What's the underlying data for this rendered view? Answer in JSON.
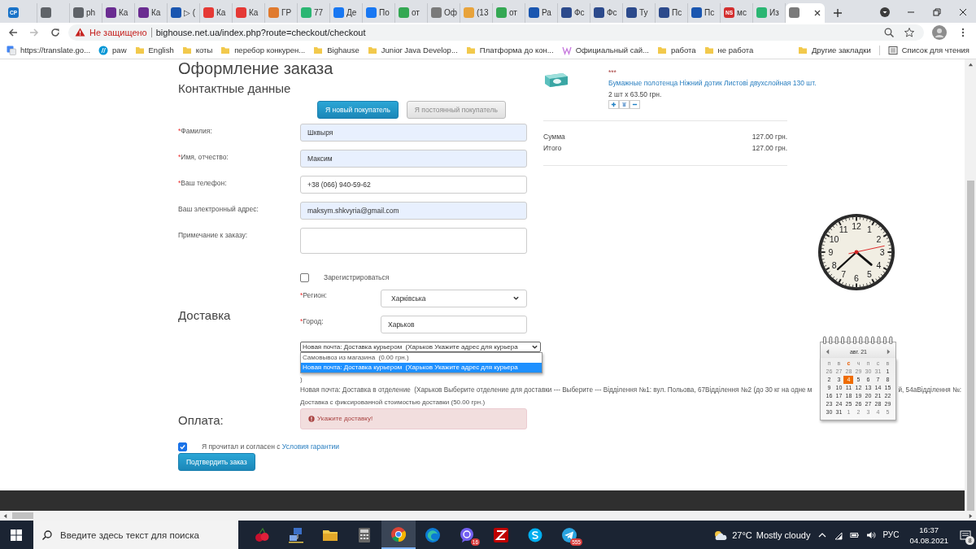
{
  "browser": {
    "tabs": [
      {
        "badge": "CP",
        "color": "#1a73c8",
        "selected": false
      },
      {
        "color": "#5f6368",
        "selected": false
      },
      {
        "title": "ph",
        "color": "#5f6368",
        "selected": false
      },
      {
        "title": "Ка",
        "color": "#6a2c91",
        "selected": false
      },
      {
        "title": "Ка",
        "color": "#6a2c91",
        "selected": false
      },
      {
        "title": "▷ (",
        "color": "#1a56b0",
        "selected": false
      },
      {
        "title": "Ка",
        "color": "#e53935",
        "selected": false
      },
      {
        "title": "Ка",
        "color": "#e53935",
        "selected": false
      },
      {
        "title": "ГР",
        "color": "#e07a2e",
        "selected": false
      },
      {
        "title": "77",
        "color": "#2bb673",
        "selected": false
      },
      {
        "title": "Де",
        "color": "#1877f2",
        "selected": false
      },
      {
        "title": "По",
        "color": "#1877f2",
        "selected": false
      },
      {
        "title": "от",
        "color": "#34a853",
        "selected": false
      },
      {
        "title": "Оф",
        "color": "#7a7a7a",
        "selected": false
      },
      {
        "title": "(13",
        "color": "#e8a33b",
        "selected": false
      },
      {
        "title": "от",
        "color": "#34a853",
        "selected": false
      },
      {
        "title": "Ра",
        "color": "#1a56b0",
        "selected": false
      },
      {
        "title": "Фс",
        "color": "#2c4a8c",
        "selected": false
      },
      {
        "title": "Фс",
        "color": "#2c4a8c",
        "selected": false
      },
      {
        "title": "Ту",
        "color": "#2c4a8c",
        "selected": false
      },
      {
        "title": "Пс",
        "color": "#2c4a8c",
        "selected": false
      },
      {
        "title": "Пс",
        "color": "#1a56b0",
        "selected": false
      },
      {
        "badge": "NS",
        "title": "мс",
        "color": "#d32f2f",
        "selected": false
      },
      {
        "title": "Из",
        "color": "#2bb673",
        "selected": false
      },
      {
        "color": "#7a7a7a",
        "selected": true
      }
    ],
    "address": {
      "security": "Не защищено",
      "url": "bighouse.net.ua/index.php?route=checkout/checkout"
    },
    "bookmarks": [
      {
        "kind": "translate",
        "label": "https://translate.go..."
      },
      {
        "kind": "hp",
        "label": "paw"
      },
      {
        "kind": "folder",
        "label": "English"
      },
      {
        "kind": "folder",
        "label": "коты"
      },
      {
        "kind": "folder",
        "label": "перебор конкурен..."
      },
      {
        "kind": "folder",
        "label": "Bighause"
      },
      {
        "kind": "folder",
        "label": "Junior Java Develop..."
      },
      {
        "kind": "folder",
        "label": "Платформа до кон..."
      },
      {
        "kind": "w",
        "label": "Официальный сай..."
      },
      {
        "kind": "folder",
        "label": "работа"
      },
      {
        "kind": "folder",
        "label": "не работа"
      }
    ],
    "other_bookmarks": "Другие закладки",
    "reading_list": "Список для чтения"
  },
  "checkout": {
    "title": "Оформление заказа",
    "contact_title": "Контактные данные",
    "account_buttons": [
      {
        "label": "Я новый покупатель",
        "selected": true
      },
      {
        "label": "Я постоянный покупатель",
        "selected": false
      }
    ],
    "fields": [
      {
        "marker": "*",
        "label": "Фамилия:",
        "value": "Шквыря",
        "autofilled": true
      },
      {
        "marker": "*",
        "label": "Имя, отчество:",
        "value": "Максим",
        "autofilled": true
      },
      {
        "marker": "*",
        "label": "Ваш телефон:",
        "value": "+38 (066) 940-59-62",
        "autofilled": false
      },
      {
        "label": "Ваш электронный адрес:",
        "value": "maksym.shkvyria@gmail.com",
        "autofilled": true
      }
    ],
    "note": {
      "label": "Примечание к заказу:"
    },
    "register": {
      "label": "Зарегистрироваться",
      "checked": false
    },
    "delivery_title": "Доставка",
    "region": {
      "marker": "*",
      "label": "Регион:",
      "value": "Харківська"
    },
    "city": {
      "marker": "*",
      "label": "Город:",
      "value": "Харьков"
    },
    "delivery_select": {
      "value": "Новая почта: Доставка курьером  (Харьков Укажите адрес для курьера",
      "expanded": true,
      "options": [
        {
          "label": "Самовывоз из магазина  (0.00 грн.)",
          "selected": false
        },
        {
          "label": "Новая почта: Доставка курьером  (Харьков Укажите адрес для курьера",
          "selected": true
        }
      ]
    },
    "closing": ")",
    "branch_line": {
      "before": "Новая почта: Доставка в отделение  (Харьков Выберите отделение для доставки --- Выберите --- Відділення №1: вул. Польова, 67Відділення №2 (до 30 кг на одне м",
      "after": "й, 54аВідділення №:"
    },
    "fixed_line": "Доставка с фиксированной стоимостью доставки  (50.00 грн.)",
    "alert": "Укажите доставку!",
    "payment_title": "Оплата:",
    "agree": {
      "checked": true,
      "text": "Я прочитал и согласен с ",
      "link": "Условия гарантии"
    },
    "confirm_button": "Подтвердить заказ"
  },
  "cart": {
    "items": [
      {
        "marker": "***",
        "name": "Бумажные полотенца Ніжний дотик Листові двухслойная 130 шт.",
        "quantity": "2 шт x 63.50 грн."
      }
    ],
    "totals": [
      {
        "label": "Сумма",
        "value": "127.00 грн."
      },
      {
        "label": "Итого",
        "value": "127.00 грн."
      }
    ]
  },
  "clock": {
    "numerals": [
      "12",
      "11",
      "1",
      "10",
      "2",
      "9",
      "3",
      "8",
      "4",
      "7",
      "5",
      "6"
    ]
  },
  "calendar": {
    "month": "авг. 21",
    "weekdays": [
      {
        "text": "п",
        "selected": false
      },
      {
        "text": "в",
        "selected": false
      },
      {
        "text": "с",
        "selected": true
      },
      {
        "text": "ч",
        "selected": false
      },
      {
        "text": "п",
        "selected": false
      },
      {
        "text": "с",
        "selected": false
      },
      {
        "text": "в",
        "selected": false
      }
    ],
    "days": [
      {
        "text": "26",
        "muted": true,
        "selected": false
      },
      {
        "text": "27",
        "muted": true,
        "selected": false
      },
      {
        "text": "28",
        "muted": true,
        "selected": false
      },
      {
        "text": "29",
        "muted": true,
        "selected": false
      },
      {
        "text": "30",
        "muted": true,
        "selected": false
      },
      {
        "text": "31",
        "muted": true,
        "selected": false
      },
      {
        "text": "1",
        "muted": false,
        "selected": false
      },
      {
        "text": "2",
        "muted": false,
        "selected": false
      },
      {
        "text": "3",
        "muted": false,
        "selected": false
      },
      {
        "text": "4",
        "muted": false,
        "selected": true
      },
      {
        "text": "5",
        "muted": false,
        "selected": false
      },
      {
        "text": "6",
        "muted": false,
        "selected": false
      },
      {
        "text": "7",
        "muted": false,
        "selected": false
      },
      {
        "text": "8",
        "muted": false,
        "selected": false
      },
      {
        "text": "9",
        "muted": false,
        "selected": false
      },
      {
        "text": "10",
        "muted": false,
        "selected": false
      },
      {
        "text": "11",
        "muted": false,
        "selected": false
      },
      {
        "text": "12",
        "muted": false,
        "selected": false
      },
      {
        "text": "13",
        "muted": false,
        "selected": false
      },
      {
        "text": "14",
        "muted": false,
        "selected": false
      },
      {
        "text": "15",
        "muted": false,
        "selected": false
      },
      {
        "text": "16",
        "muted": false,
        "selected": false
      },
      {
        "text": "17",
        "muted": false,
        "selected": false
      },
      {
        "text": "18",
        "muted": false,
        "selected": false
      },
      {
        "text": "19",
        "muted": false,
        "selected": false
      },
      {
        "text": "20",
        "muted": false,
        "selected": false
      },
      {
        "text": "21",
        "muted": false,
        "selected": false
      },
      {
        "text": "22",
        "muted": false,
        "selected": false
      },
      {
        "text": "23",
        "muted": false,
        "selected": false
      },
      {
        "text": "24",
        "muted": false,
        "selected": false
      },
      {
        "text": "25",
        "muted": false,
        "selected": false
      },
      {
        "text": "26",
        "muted": false,
        "selected": false
      },
      {
        "text": "27",
        "muted": false,
        "selected": false
      },
      {
        "text": "28",
        "muted": false,
        "selected": false
      },
      {
        "text": "29",
        "muted": false,
        "selected": false
      },
      {
        "text": "30",
        "muted": false,
        "selected": false
      },
      {
        "text": "31",
        "muted": false,
        "selected": false
      },
      {
        "text": "1",
        "muted": true,
        "selected": false
      },
      {
        "text": "2",
        "muted": true,
        "selected": false
      },
      {
        "text": "3",
        "muted": true,
        "selected": false
      },
      {
        "text": "4",
        "muted": true,
        "selected": false
      },
      {
        "text": "5",
        "muted": true,
        "selected": false
      }
    ]
  },
  "taskbar": {
    "search_placeholder": "Введите здесь текст для поиска",
    "apps": [
      {
        "kind": "cherry",
        "selected": false
      },
      {
        "kind": "network",
        "selected": false
      },
      {
        "kind": "folder",
        "selected": false
      },
      {
        "kind": "calculator",
        "selected": false
      },
      {
        "kind": "chrome",
        "selected": true
      },
      {
        "kind": "edge",
        "selected": false
      },
      {
        "kind": "viber",
        "badge": "16",
        "selected": false
      },
      {
        "kind": "filezilla",
        "selected": false
      },
      {
        "kind": "skype",
        "selected": false
      },
      {
        "kind": "telegram",
        "badge": "555",
        "selected": false
      }
    ],
    "weather": {
      "temp": "27°C",
      "text": "Mostly cloudy"
    },
    "language": "РУС",
    "time": "16:37",
    "date": "04.08.2021",
    "notifications": "8"
  }
}
